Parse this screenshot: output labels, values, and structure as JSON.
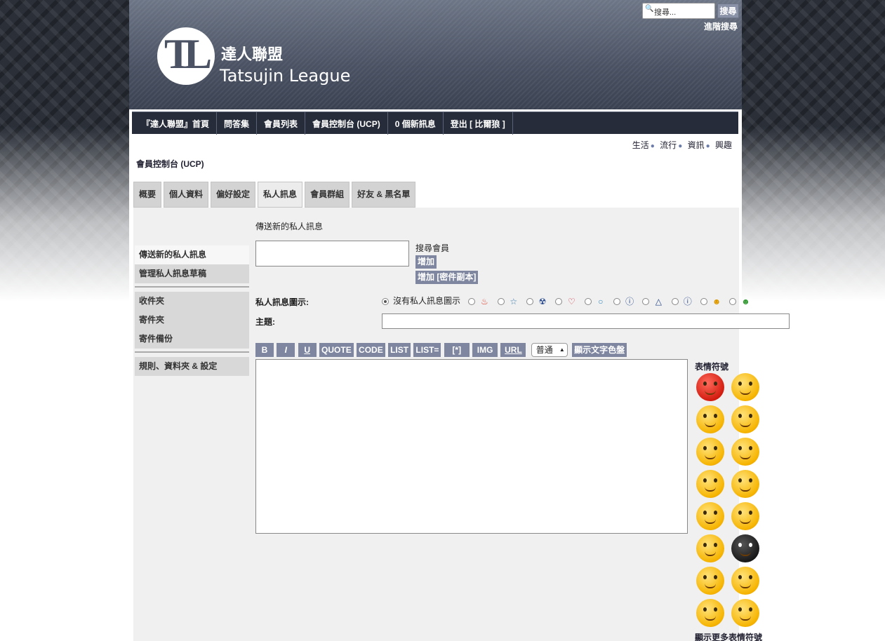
{
  "header": {
    "logo_zh": "達人聯盟",
    "logo_en": "Tatsujin League",
    "search_placeholder": "搜尋...",
    "search_button": "搜尋",
    "advanced_search": "進階搜尋"
  },
  "nav": {
    "items": [
      {
        "label": "『達人聯盟』首頁"
      },
      {
        "label": "問答集"
      },
      {
        "label": "會員列表"
      },
      {
        "label": "會員控制台 (UCP)"
      },
      {
        "label": "0 個新訊息"
      },
      {
        "label": "登出 [ 比爾狼 ]"
      }
    ]
  },
  "forum_links": [
    "生活",
    "流行",
    "資訊",
    "興趣"
  ],
  "ucp_title": "會員控制台 (UCP)",
  "tabs": [
    {
      "label": "概要"
    },
    {
      "label": "個人資料"
    },
    {
      "label": "偏好設定"
    },
    {
      "label": "私人訊息",
      "active": true
    },
    {
      "label": "會員群組"
    },
    {
      "label": "好友 & 黑名單"
    }
  ],
  "sidebar": {
    "group1": [
      "傳送新的私人訊息",
      "管理私人訊息草稿"
    ],
    "group2": [
      "收件夾",
      "寄件夾",
      "寄件備份"
    ],
    "group3": [
      "規則、資料夾 & 設定"
    ]
  },
  "compose": {
    "title": "傳送新的私人訊息",
    "find_member": "搜尋會員",
    "add": "增加",
    "add_bcc": "增加 [密件副本]",
    "icon_label": "私人訊息圖示:",
    "no_icon": "沒有私人訊息圖示",
    "subject_label": "主題:",
    "icons": [
      "fire-icon",
      "star-icon",
      "radioactive-icon",
      "heart-icon",
      "speech-bubble-icon",
      "question-icon",
      "warning-icon",
      "info-icon",
      "smiley-icon",
      "alien-icon"
    ]
  },
  "toolbar": {
    "buttons": [
      "B",
      "I",
      "U",
      "QUOTE",
      "CODE",
      "LIST",
      "LIST=",
      "[*]",
      "IMG",
      "URL"
    ],
    "font_size": "普通",
    "color_button": "顯示文字色盤"
  },
  "smilies": {
    "title": "表情符號",
    "more": "顯示更多表情符號",
    "items": [
      "mad-smiley-icon",
      "rolling-eyes-smiley-icon",
      "cool-smiley-icon",
      "crying-smiley-icon",
      "surprised-smiley-icon",
      "confused-smiley-icon",
      "in-love-smiley-icon",
      "grin-smiley-icon",
      "shocked-smiley-icon",
      "silent-smiley-icon",
      "sad-smiley-icon",
      "evil-smiley-icon",
      "sleepy-smiley-icon",
      "wondering-smiley-icon",
      "sweat-smiley-icon",
      "tongue-smiley-icon"
    ]
  },
  "colors": {
    "nav_bg": "#262c39",
    "button_bg": "#7e86a0",
    "panel_bg": "#f0f0f0"
  }
}
